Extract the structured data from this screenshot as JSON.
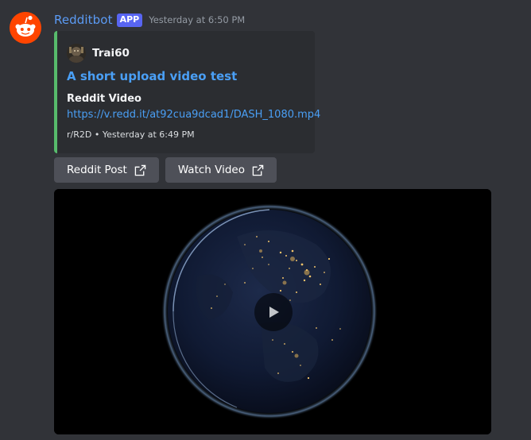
{
  "message": {
    "author": {
      "username": "Redditbot",
      "badge": "APP",
      "timestamp": "Yesterday at 6:50 PM",
      "avatar_icon": "reddit-snoo-icon",
      "avatar_color": "#ff4500"
    },
    "embed": {
      "accent_color": "#57bb6c",
      "author_name": "Trai60",
      "title": "A short upload video test",
      "field_name": "Reddit Video",
      "field_value": "https://v.redd.it/at92cua9dcad1/DASH_1080.mp4",
      "footer": "r/R2D • Yesterday at 6:49 PM"
    },
    "buttons": [
      {
        "label": "Reddit Post",
        "icon": "external-link-icon"
      },
      {
        "label": "Watch Video",
        "icon": "external-link-icon"
      }
    ],
    "video": {
      "thumbnail": "earth-at-night",
      "play_icon": "play-icon"
    }
  }
}
